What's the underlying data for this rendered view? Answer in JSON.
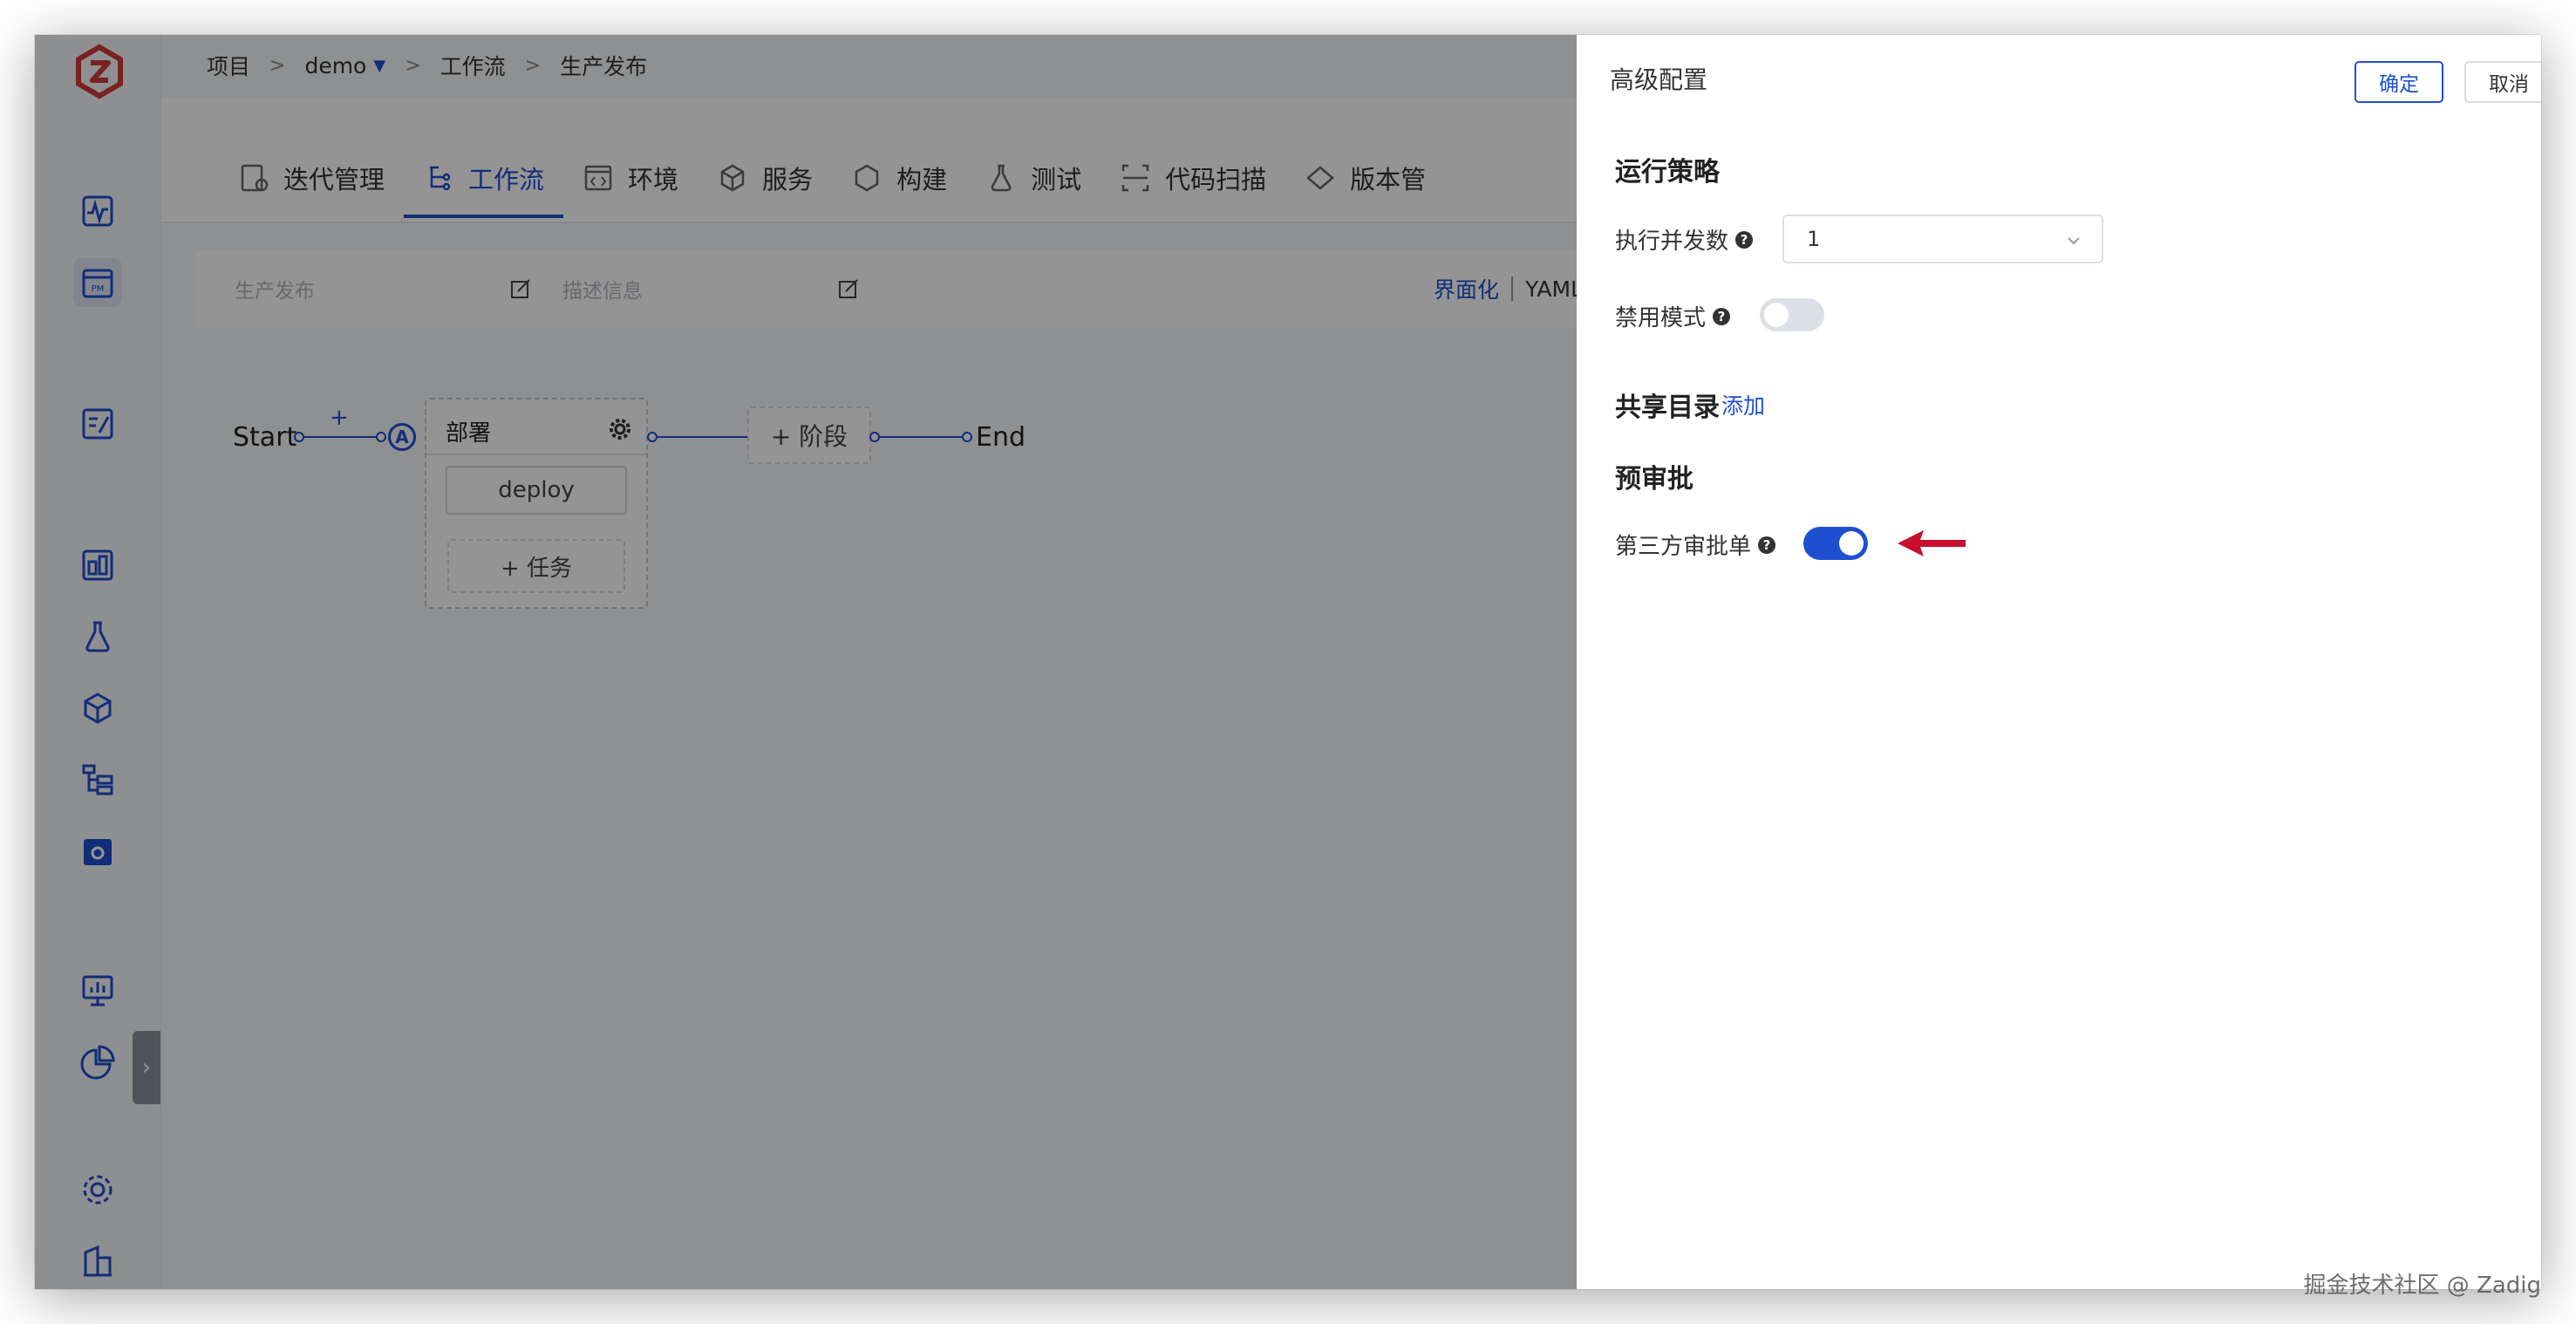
{
  "breadcrumb": {
    "items": [
      "项目",
      "demo",
      "工作流",
      "生产发布"
    ],
    "separator": ">"
  },
  "tabs": [
    {
      "label": "迭代管理",
      "icon": "iteration-icon"
    },
    {
      "label": "工作流",
      "icon": "workflow-icon",
      "active": true
    },
    {
      "label": "环境",
      "icon": "environment-icon"
    },
    {
      "label": "服务",
      "icon": "service-icon"
    },
    {
      "label": "构建",
      "icon": "build-icon"
    },
    {
      "label": "测试",
      "icon": "test-icon"
    },
    {
      "label": "代码扫描",
      "icon": "code-scan-icon"
    },
    {
      "label": "版本管",
      "icon": "version-icon"
    }
  ],
  "workflow": {
    "name_placeholder": "生产发布",
    "desc_placeholder": "描述信息",
    "mode_ui": "界面化",
    "mode_yaml": "YAML"
  },
  "flow": {
    "start": "Start",
    "end": "End",
    "add_symbol": "+",
    "approval_badge": "A",
    "stage_name": "部署",
    "job_name": "deploy",
    "add_job": "+ 任务",
    "add_stage": "+ 阶段"
  },
  "drawer": {
    "title": "高级配置",
    "confirm": "确定",
    "cancel": "取消",
    "run_policy_title": "运行策略",
    "concurrency_label": "执行并发数",
    "concurrency_value": "1",
    "disable_label": "禁用模式",
    "disable_enabled": false,
    "shared_dir_title": "共享目录",
    "shared_dir_add": "添加",
    "pre_approval_title": "预审批",
    "third_party_label": "第三方审批单",
    "third_party_enabled": true
  },
  "colors": {
    "accent": "#1f4fd1",
    "arrow": "#c8102e",
    "overlay": "rgba(0,0,0,0.42)"
  },
  "watermark": "掘金技术社区 @ Zadig"
}
